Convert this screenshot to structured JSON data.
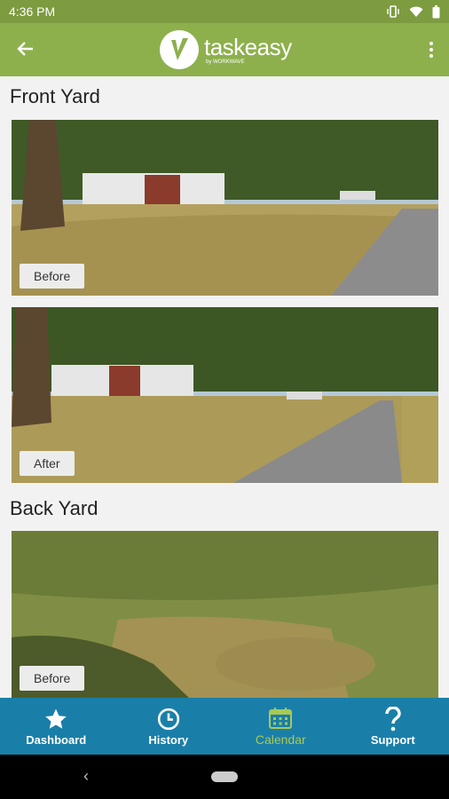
{
  "status": {
    "time": "4:36 PM",
    "icons": [
      "vibrate-icon",
      "wifi-icon",
      "battery-icon"
    ]
  },
  "app_bar": {
    "back_icon": "arrow-left-icon",
    "logo_text": "taskeasy",
    "logo_sub": "by WORKWAVE",
    "menu_icon": "more-vert-icon"
  },
  "sections": [
    {
      "title": "Front Yard",
      "photos": [
        {
          "label": "Before"
        },
        {
          "label": "After"
        }
      ]
    },
    {
      "title": "Back Yard",
      "photos": [
        {
          "label": "Before"
        }
      ]
    }
  ],
  "nav": {
    "items": [
      {
        "label": "Dashboard",
        "icon": "star-icon"
      },
      {
        "label": "History",
        "icon": "clock-icon"
      },
      {
        "label": "Calendar",
        "icon": "calendar-icon"
      },
      {
        "label": "Support",
        "icon": "question-icon"
      }
    ],
    "active": "Calendar"
  },
  "colors": {
    "status_bar": "#7d9b3f",
    "app_bar": "#8db04d",
    "bottom_nav": "#1a7fa8",
    "active_nav": "#a8c956"
  }
}
